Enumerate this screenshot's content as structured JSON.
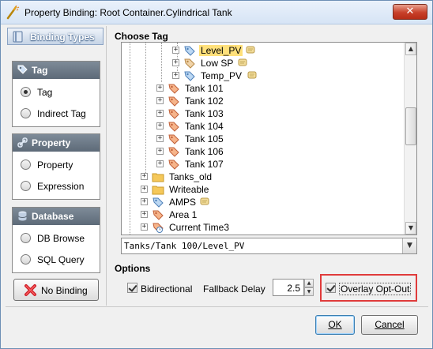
{
  "window": {
    "title": "Property Binding: Root Container.Cylindrical Tank",
    "close_glyph": "✕",
    "icon": "wand-icon"
  },
  "left_panel": {
    "header": "Binding Types",
    "groups": [
      {
        "title": "Tag",
        "icon": "tag-icon",
        "options": [
          {
            "label": "Tag",
            "selected": true
          },
          {
            "label": "Indirect Tag",
            "selected": false
          }
        ]
      },
      {
        "title": "Property",
        "icon": "link-icon",
        "options": [
          {
            "label": "Property",
            "selected": false
          },
          {
            "label": "Expression",
            "selected": false
          }
        ]
      },
      {
        "title": "Database",
        "icon": "database-icon",
        "options": [
          {
            "label": "DB Browse",
            "selected": false
          },
          {
            "label": "SQL Query",
            "selected": false
          }
        ]
      }
    ],
    "no_binding_label": "No Binding"
  },
  "choose_tag": {
    "title": "Choose Tag",
    "tree": [
      {
        "label": "Level_PV",
        "icon": "tag-blue-icon",
        "note": true,
        "selected": true
      },
      {
        "label": "Low SP",
        "icon": "tag-tan-icon",
        "note": true
      },
      {
        "label": "Temp_PV",
        "icon": "tag-blue-icon",
        "note": true
      },
      {
        "label": "Tank 101",
        "icon": "tag-orange-icon"
      },
      {
        "label": "Tank 102",
        "icon": "tag-orange-icon"
      },
      {
        "label": "Tank 103",
        "icon": "tag-orange-icon"
      },
      {
        "label": "Tank 104",
        "icon": "tag-orange-icon"
      },
      {
        "label": "Tank 105",
        "icon": "tag-orange-icon"
      },
      {
        "label": "Tank 106",
        "icon": "tag-orange-icon"
      },
      {
        "label": "Tank 107",
        "icon": "tag-orange-icon"
      },
      {
        "label": "Tanks_old",
        "icon": "folder-icon"
      },
      {
        "label": "Writeable",
        "icon": "folder-icon"
      },
      {
        "label": "AMPS",
        "icon": "tag-blue-icon",
        "note": true
      },
      {
        "label": "Area 1",
        "icon": "tag-orange-icon"
      },
      {
        "label": "Current Time3",
        "icon": "clock-tag-icon"
      }
    ],
    "path": "Tanks/Tank 100/Level_PV"
  },
  "options": {
    "title": "Options",
    "bidirectional_label": "Bidirectional",
    "bidirectional_checked": true,
    "fallback_label": "Fallback Delay",
    "fallback_value": "2.5",
    "overlay_label": "Overlay Opt-Out",
    "overlay_checked": true
  },
  "buttons": {
    "ok": "OK",
    "cancel": "Cancel"
  },
  "colors": {
    "selection": "#ffe07a",
    "highlight_box": "#e03b3b",
    "group_title": "#6b7886"
  }
}
